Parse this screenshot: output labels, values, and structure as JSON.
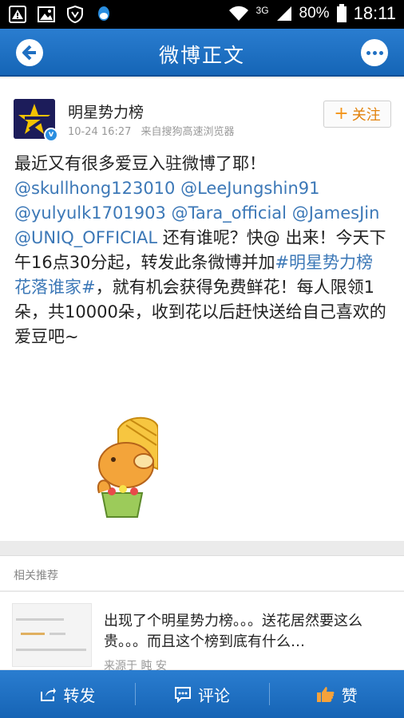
{
  "status_bar": {
    "network": "3G",
    "battery": "80%",
    "time": "18:11"
  },
  "title_bar": {
    "title": "微博正文"
  },
  "post": {
    "author": "明星势力榜",
    "time": "10-24 16:27",
    "source": "来自搜狗高速浏览器",
    "follow_label": "关注",
    "text": {
      "p1": "最近又有很多爱豆入驻微博了耶！",
      "m1": "@skullhong123010",
      "m2": "@LeeJungshin91",
      "m3": "@yulyulk1701903",
      "m4": "@Tara_official",
      "m5": "@JamesJin",
      "m6": "@UNIQ_OFFICIAL",
      "p2": " 还有谁呢？快@ 出来！今天下午16点30分起，转发此条微博并加",
      "topic": "#明星势力榜花落谁家#",
      "p3": "，就有机会获得免费鲜花！每人限领1朵，共10000朵，收到花以后赶快送给自己喜欢的爱豆吧~"
    }
  },
  "related": {
    "header": "相关推荐",
    "item": {
      "title": "出现了个明星势力榜。。。送花居然要这么贵。。。而且这个榜到底有什么…",
      "source": "来源于 盹 安"
    }
  },
  "toolbar": {
    "repost": "转发",
    "comment": "评论",
    "like": "赞"
  },
  "colors": {
    "brand_blue": "#1f6fc2",
    "link": "#3c78b7",
    "follow": "#e2820c"
  }
}
